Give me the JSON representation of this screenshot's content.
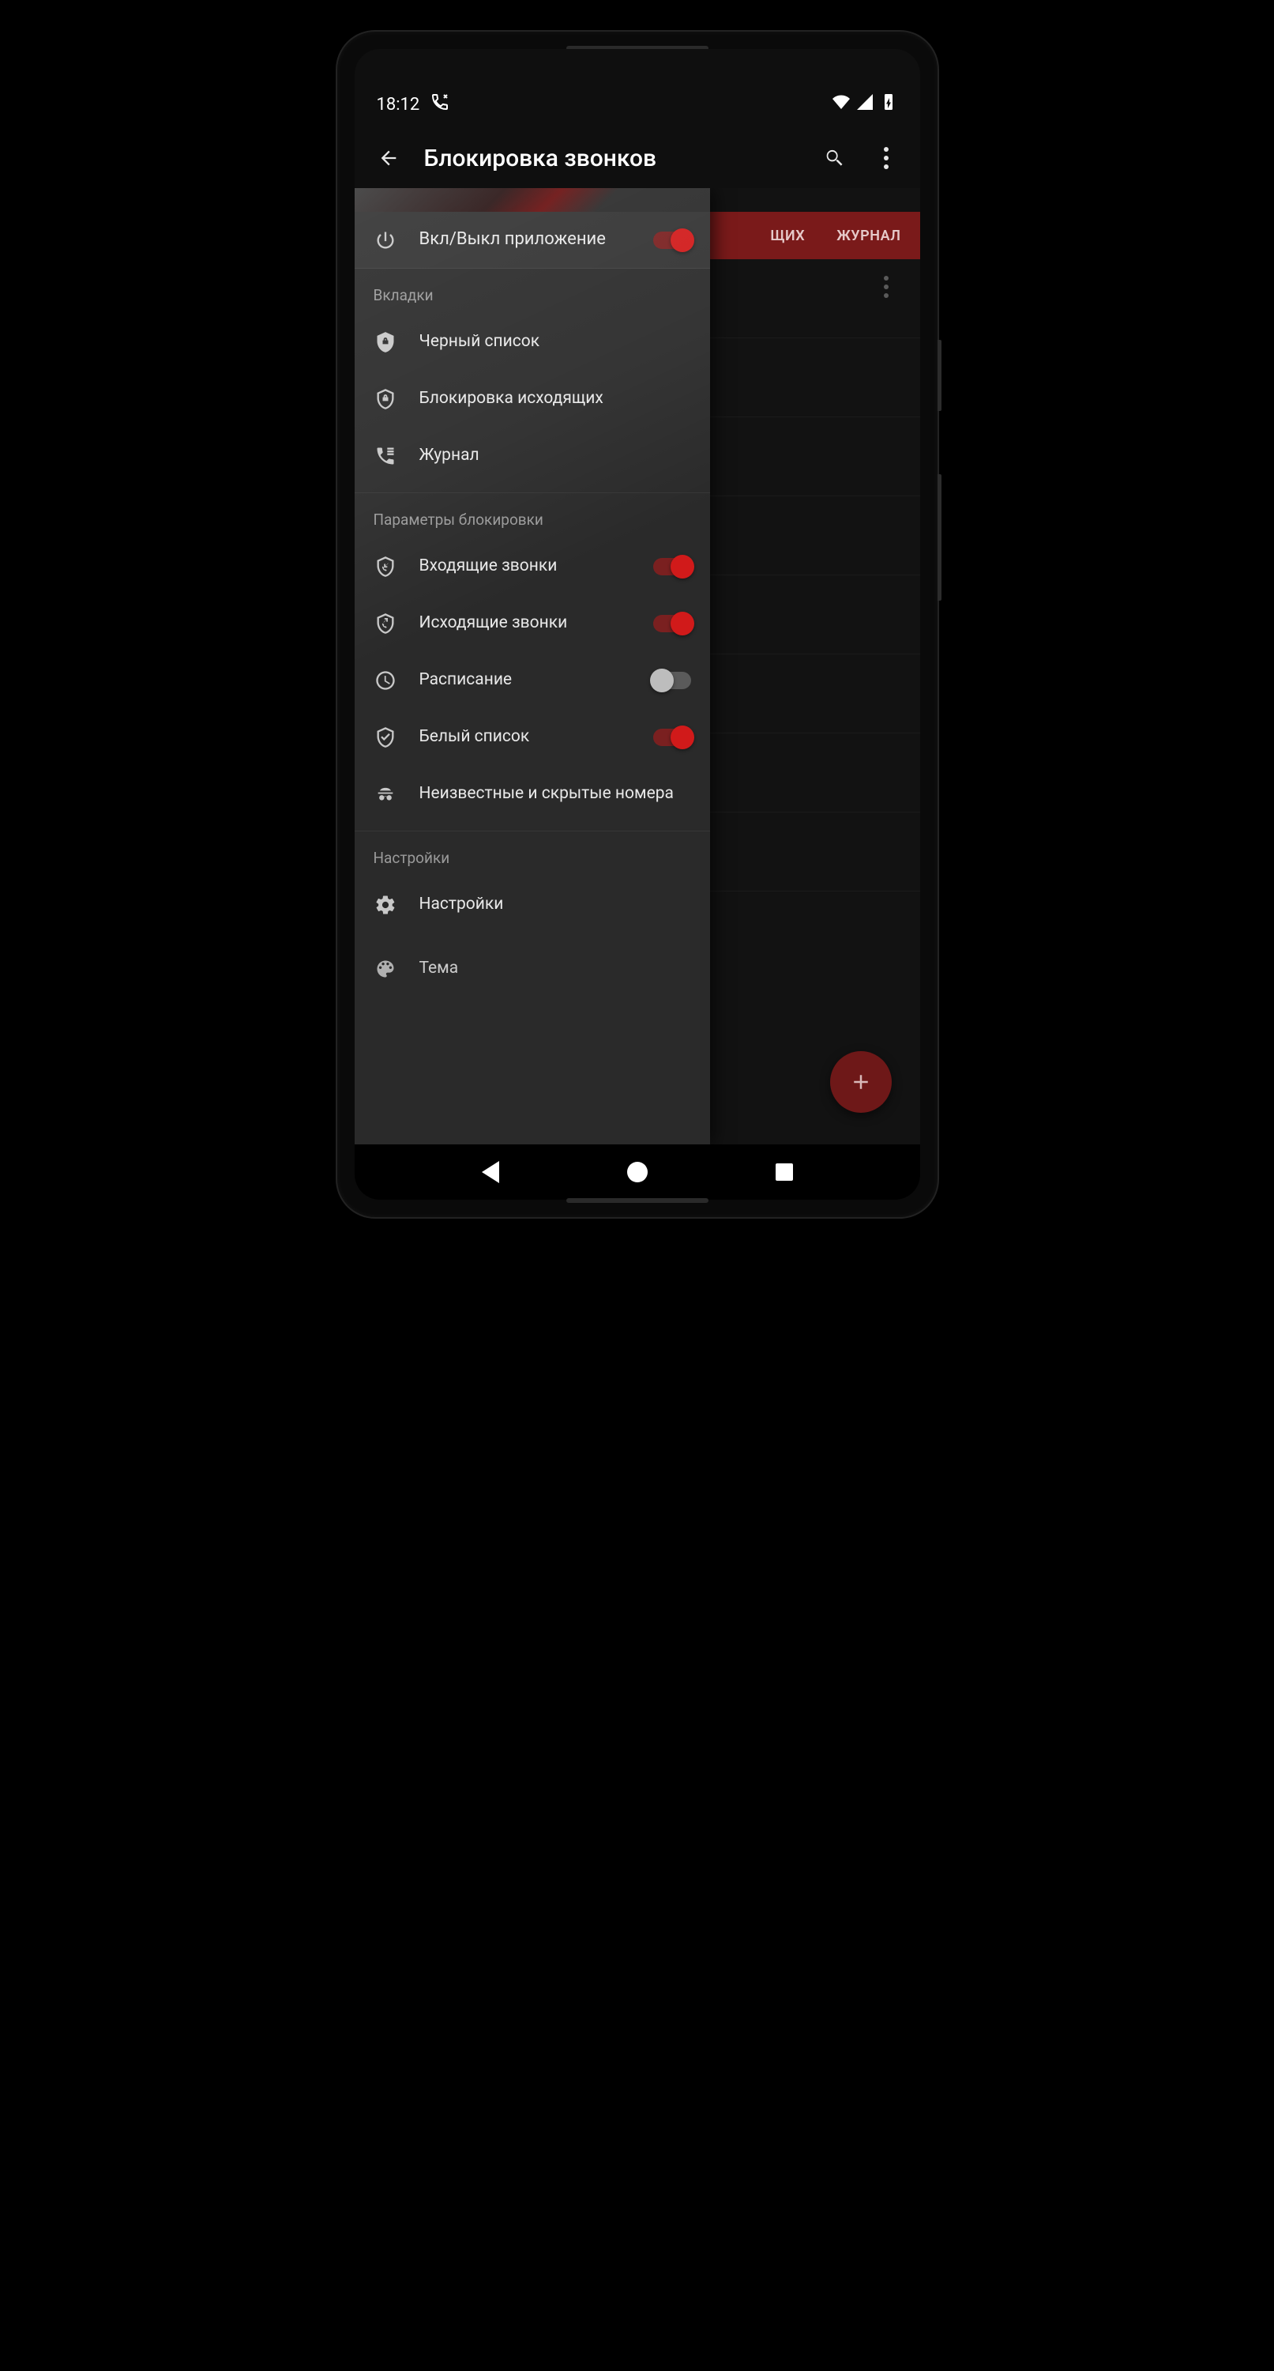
{
  "status": {
    "time": "18:12"
  },
  "appbar": {
    "title": "Блокировка звонков"
  },
  "tabs": {
    "partial": "ЩИХ",
    "log": "ЖУРНАЛ"
  },
  "drawer": {
    "power": {
      "label": "Вкл/Выкл приложение"
    },
    "section_tabs": "Вкладки",
    "tab_items": {
      "blacklist": "Черный список",
      "outgoing_block": "Блокировка исходящих",
      "log": "Журнал"
    },
    "section_params": "Параметры блокировки",
    "params": {
      "incoming": "Входящие звонки",
      "outgoing": "Исходящие звонки",
      "schedule": "Расписание",
      "whitelist": "Белый список",
      "unknown": "Неизвестные и скрытые номера"
    },
    "section_settings": "Настройки",
    "settings_items": {
      "settings": "Настройки",
      "theme": "Тема"
    }
  },
  "colors": {
    "accent": "#d11a1a"
  }
}
